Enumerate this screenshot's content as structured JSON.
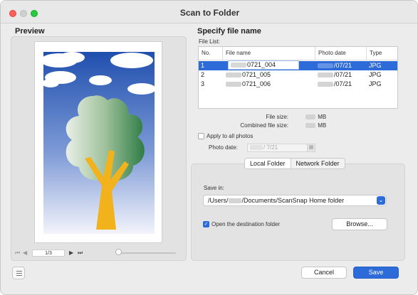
{
  "window": {
    "title": "Scan to Folder"
  },
  "preview": {
    "heading": "Preview",
    "page_indicator": "1/3",
    "nav": {
      "first": "⏮",
      "prev": "◀",
      "next": "▶",
      "last": "⏭"
    }
  },
  "file_section": {
    "heading": "Specify file name",
    "file_list_label": "File List:",
    "columns": [
      "No.",
      "File name",
      "Photo date",
      "Type"
    ],
    "rows": [
      {
        "no": "1",
        "name": "0721_004",
        "date": "/07/21",
        "type": "JPG"
      },
      {
        "no": "2",
        "name": "0721_005",
        "date": "/07/21",
        "type": "JPG"
      },
      {
        "no": "3",
        "name": "0721_006",
        "date": "/07/21",
        "type": "JPG"
      }
    ],
    "file_size_label": "File size:",
    "file_size_unit": "MB",
    "combined_size_label": "Combined file size:",
    "combined_size_unit": "MB",
    "apply_all_label": "Apply to all photos",
    "photo_date_label": "Photo date:",
    "photo_date_value": "/ 7/21"
  },
  "folder_section": {
    "tabs": [
      "Local Folder",
      "Network Folder"
    ],
    "save_in_label": "Save in:",
    "save_path_prefix": "/Users/",
    "save_path_suffix": "/Documents/ScanSnap Home folder",
    "open_destination_label": "Open the destination folder",
    "browse_label": "Browse..."
  },
  "footer": {
    "cancel_label": "Cancel",
    "save_label": "Save"
  },
  "colors": {
    "accent": "#2c6bd8",
    "selection": "#2c6bd8",
    "tree_trunk": "#f2b21b"
  }
}
